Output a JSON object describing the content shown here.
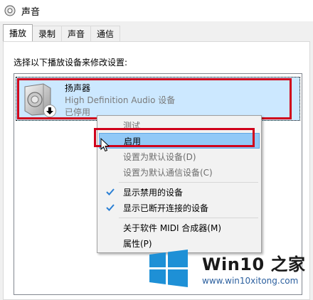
{
  "window": {
    "title": "声音",
    "title_icon": "speaker-settings-icon"
  },
  "tabs": [
    {
      "label": "播放",
      "active": true
    },
    {
      "label": "录制",
      "active": false
    },
    {
      "label": "声音",
      "active": false
    },
    {
      "label": "通信",
      "active": false
    }
  ],
  "instruction": "选择以下播放设备来修改设置:",
  "device": {
    "name": "扬声器",
    "description": "High Definition Audio 设备",
    "status": "已停用",
    "icon": "speaker-icon",
    "status_icon": "disabled-down-arrow-icon"
  },
  "context_menu": {
    "items": [
      {
        "label": "测试",
        "enabled": false,
        "checked": false
      },
      {
        "label": "启用",
        "enabled": true,
        "checked": false,
        "hovered": true
      },
      {
        "label": "设置为默认设备(D)",
        "enabled": false,
        "checked": false
      },
      {
        "label": "设置为默认通信设备(C)",
        "enabled": false,
        "checked": false
      },
      {
        "label": "显示禁用的设备",
        "enabled": true,
        "checked": true
      },
      {
        "label": "显示已断开连接的设备",
        "enabled": true,
        "checked": true
      },
      {
        "label": "关于软件 MIDI 合成器(M)",
        "enabled": true,
        "checked": false
      },
      {
        "label": "属性(P)",
        "enabled": true,
        "checked": false
      }
    ]
  },
  "colors": {
    "highlight_border": "#d0021b",
    "selection": "#cce8ff",
    "menu_hover": "#91c9f7",
    "check": "#2a7fd4"
  },
  "watermark": {
    "brand": "Win10 之家",
    "url": "www.win10xitong.com"
  }
}
